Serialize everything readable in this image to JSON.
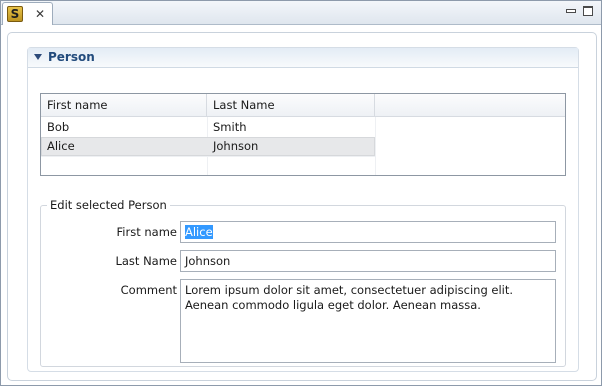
{
  "tab": {
    "icon": "S",
    "close_glyph": "✕"
  },
  "section": {
    "title": "Person"
  },
  "table": {
    "columns": [
      "First name",
      "Last Name"
    ],
    "rows": [
      {
        "first": "Bob",
        "last": "Smith"
      },
      {
        "first": "Alice",
        "last": "Johnson"
      }
    ],
    "selected_row": 1
  },
  "edit": {
    "group_title": "Edit selected Person",
    "first_name_label": "First name",
    "first_name_value": "Alice",
    "last_name_label": "Last Name",
    "last_name_value": "Johnson",
    "comment_label": "Comment",
    "comment_value": "Lorem ipsum dolor sit amet, consectetuer adipiscing elit.\nAenean commodo ligula eget dolor. Aenean massa."
  }
}
